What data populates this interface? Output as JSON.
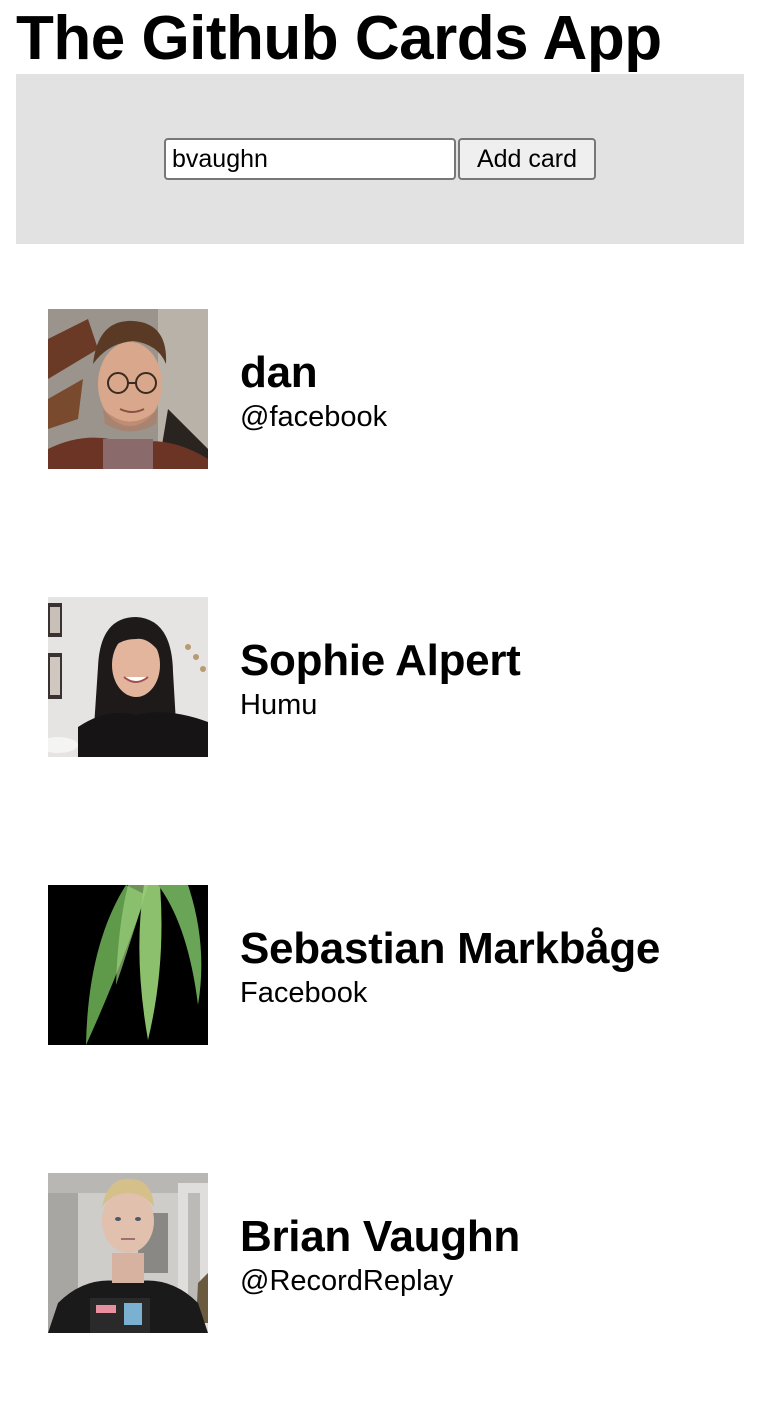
{
  "app": {
    "title": "The Github Cards App"
  },
  "form": {
    "input_value": "bvaughn",
    "button_label": "Add card"
  },
  "cards": [
    {
      "name": "dan",
      "company": "@facebook"
    },
    {
      "name": "Sophie Alpert",
      "company": "Humu"
    },
    {
      "name": "Sebastian Markbåge",
      "company": "Facebook"
    },
    {
      "name": "Brian Vaughn",
      "company": "@RecordReplay"
    }
  ],
  "colors": {
    "form_background": "#e3e2e2",
    "page_background": "#ffffff"
  }
}
